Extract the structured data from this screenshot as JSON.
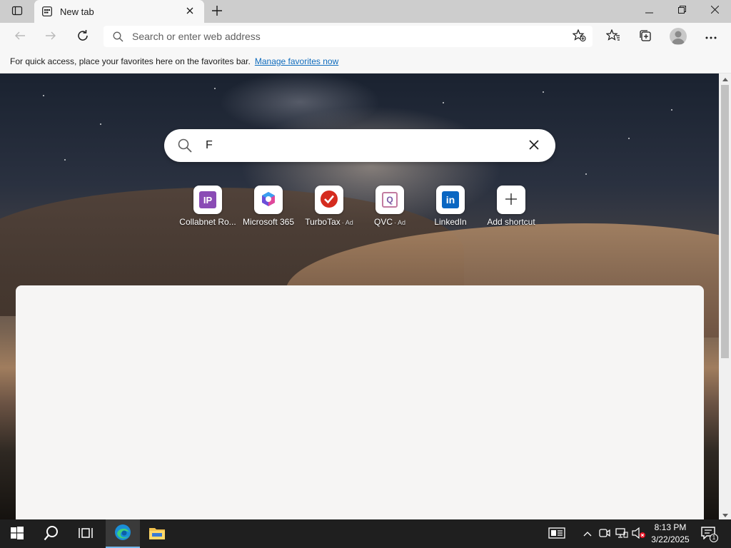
{
  "browser": {
    "tab": {
      "title": "New tab"
    },
    "address_bar": {
      "placeholder": "Search or enter web address"
    }
  },
  "favorites_bar": {
    "message": "For quick access, place your favorites here on the favorites bar.",
    "link": "Manage favorites now"
  },
  "new_tab_page": {
    "search": {
      "value": "F"
    },
    "shortcuts": [
      {
        "label": "Collabnet Ro...",
        "ad": "",
        "icon": "ip-icon",
        "tile_text": "IP"
      },
      {
        "label": "Microsoft 365",
        "ad": "",
        "icon": "microsoft365-icon"
      },
      {
        "label": "TurboTax",
        "ad": "· Ad",
        "icon": "turbotax-icon"
      },
      {
        "label": "QVC",
        "ad": "· Ad",
        "icon": "qvc-icon",
        "tile_text": "Q"
      },
      {
        "label": "LinkedIn",
        "ad": "",
        "icon": "linkedin-icon",
        "tile_text": "in"
      },
      {
        "label": "Add shortcut",
        "ad": "",
        "icon": "plus-icon",
        "tile_text": "+"
      }
    ]
  },
  "taskbar": {
    "clock": {
      "time": "8:13 PM",
      "date": "3/22/2025"
    },
    "notification_count": "1"
  },
  "colors": {
    "tabstrip": "#cdcdcd",
    "toolbar": "#f7f7f7",
    "link": "#0f6cbd",
    "taskbar": "#1f1f1f",
    "edge_accent": "#76b9ed"
  }
}
